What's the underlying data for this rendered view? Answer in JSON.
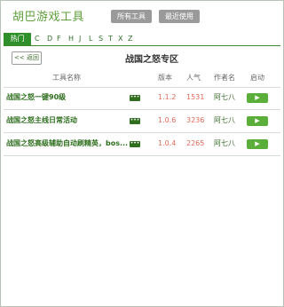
{
  "app": {
    "title": "胡巴游戏工具",
    "buttons": {
      "all_tools": "所有工具",
      "recent": "最近使用"
    }
  },
  "tabs": {
    "hot": "热门",
    "letters": [
      "C",
      "D",
      "F",
      "H",
      "J",
      "L",
      "S",
      "T",
      "X",
      "Z"
    ]
  },
  "zone": {
    "back_label": "<< 返回",
    "title": "战国之怒专区"
  },
  "table": {
    "headers": {
      "name": "工具名称",
      "version": "版本",
      "popularity": "人气",
      "author": "作者名",
      "start": "启动"
    },
    "rows": [
      {
        "name": "战国之怒一键90级",
        "version": "1.1.2",
        "popularity": "1531",
        "author": "阿七八",
        "more_icon": "•••",
        "start_icon": "▶"
      },
      {
        "name": "战国之怒主线日常活动",
        "version": "1.0.6",
        "popularity": "3236",
        "author": "阿七八",
        "more_icon": "•••",
        "start_icon": "▶"
      },
      {
        "name": "战国之怒高级辅助自动刷精英，bos...",
        "version": "1.0.4",
        "popularity": "2265",
        "author": "阿七八",
        "more_icon": "•••",
        "start_icon": "▶"
      }
    ]
  },
  "colors": {
    "brand_green": "#5fa03c",
    "tab_green": "#2f8f2a",
    "value_red": "#e06a5a",
    "button_gray": "#9a9a9a"
  }
}
